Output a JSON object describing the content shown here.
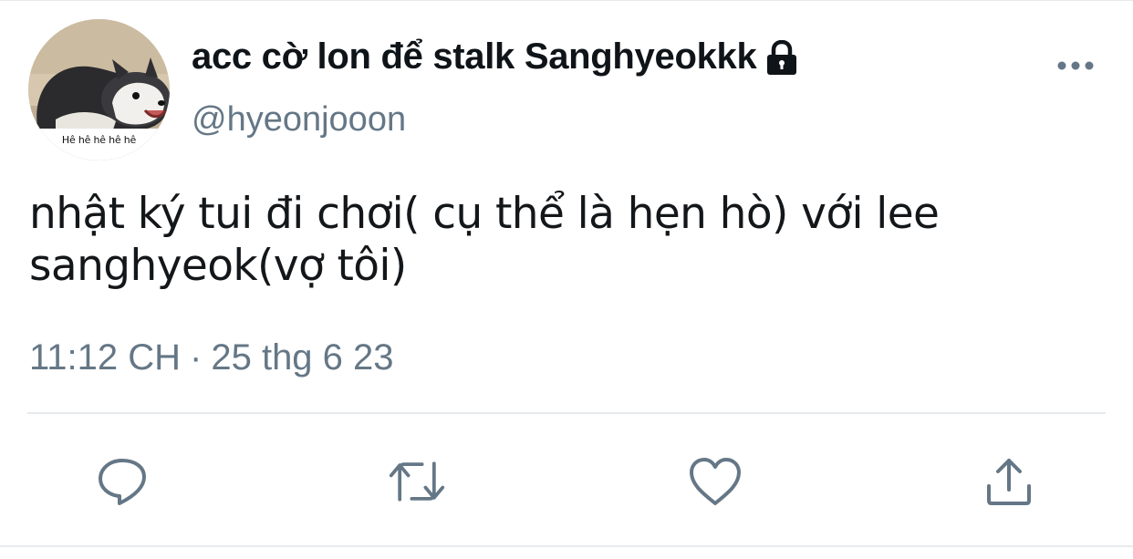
{
  "tweet": {
    "author": {
      "display_name": "acc cờ lon để stalk Sanghyeokkk",
      "handle": "@hyeonjooon",
      "avatar_caption": "Hê hê hê hê hê",
      "protected_icon": "lock-icon"
    },
    "text": "nhật ký tui đi chơi( cụ thể là hẹn hò) với lee sanghyeok(vợ tôi)",
    "time": "11:12 CH",
    "separator": "·",
    "date": "25 thg 6 23",
    "menu_icon": "more-horizontal-icon",
    "actions": [
      {
        "name": "reply",
        "icon": "reply-icon"
      },
      {
        "name": "retweet",
        "icon": "retweet-icon"
      },
      {
        "name": "like",
        "icon": "heart-icon"
      },
      {
        "name": "share",
        "icon": "share-icon"
      }
    ]
  },
  "colors": {
    "text_primary": "#14171a",
    "text_secondary": "#657786",
    "icon": "#657786",
    "divider": "#e6e9ec",
    "background": "#ffffff"
  }
}
